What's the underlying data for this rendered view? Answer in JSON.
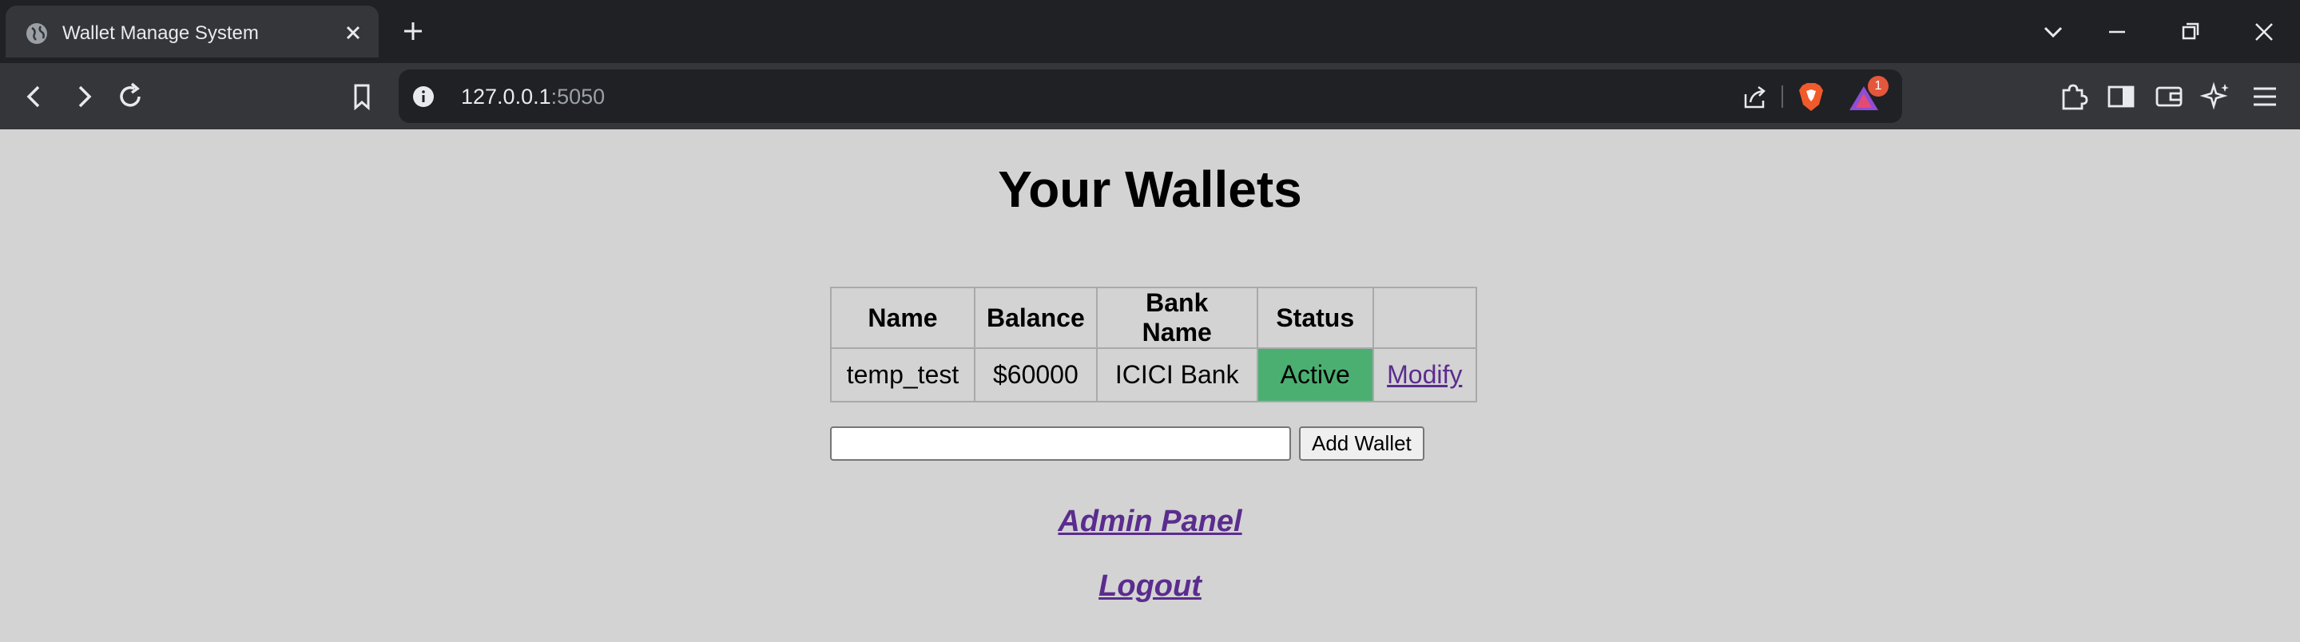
{
  "browser": {
    "tab_title": "Wallet Manage System",
    "url_host": "127.0.0.1",
    "url_port": ":5050",
    "rewards_badge": "1"
  },
  "page": {
    "title": "Your Wallets",
    "table": {
      "headers": [
        "Name",
        "Balance",
        "Bank Name",
        "Status",
        ""
      ],
      "rows": [
        {
          "name": "temp_test",
          "balance": "$60000",
          "bank": "ICICI Bank",
          "status": "Active",
          "action": "Modify"
        }
      ]
    },
    "add_wallet": {
      "input_value": "",
      "button_label": "Add Wallet"
    },
    "links": {
      "admin_panel": "Admin Panel",
      "logout": "Logout"
    }
  },
  "colors": {
    "status_active": "#4caf72",
    "link": "#5b2c8e",
    "page_bg": "#d3d3d3"
  }
}
